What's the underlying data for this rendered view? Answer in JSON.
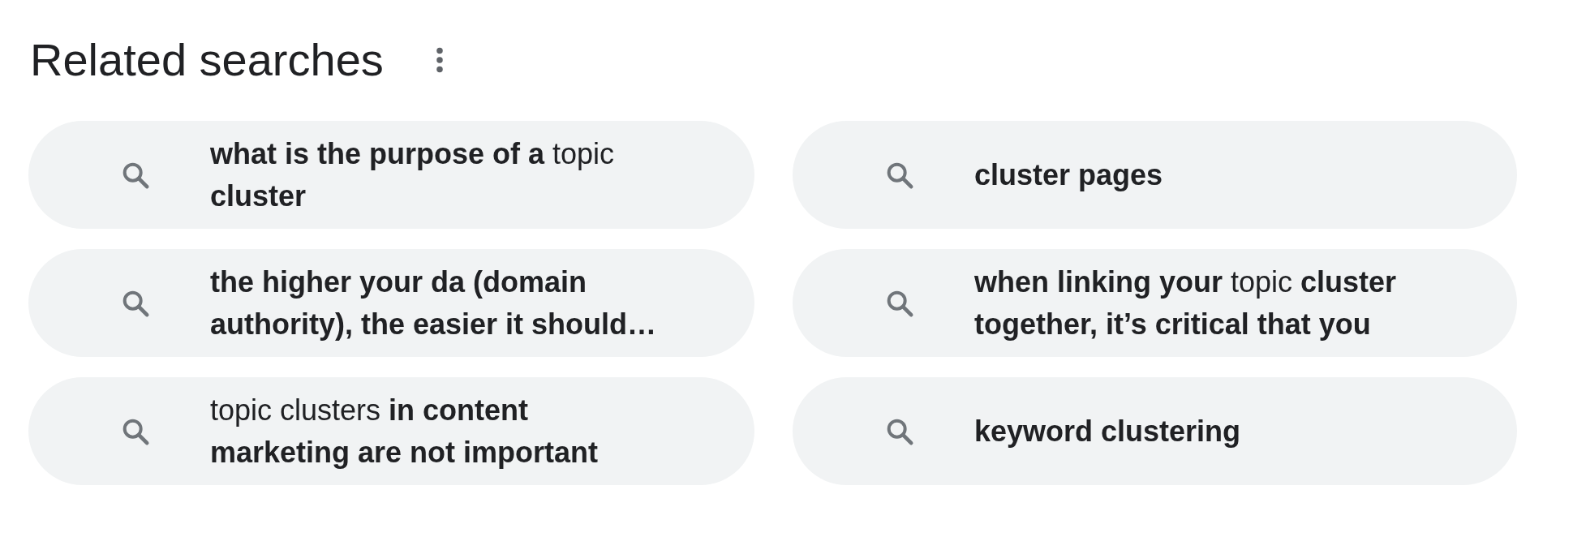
{
  "heading": {
    "title": "Related searches"
  },
  "searches": [
    {
      "text": "**what is the purpose of a** topic\n**cluster**",
      "bold": false
    },
    {
      "text": "cluster pages",
      "bold": true
    },
    {
      "text": "the higher your da (domain\nauthority), the easier it should…",
      "bold": true
    },
    {
      "text": "**when linking your** topic **cluster**\n**together, it’s critical that you**",
      "bold": false
    },
    {
      "text": "topic clusters **in content**\n**marketing are not important**",
      "bold": false
    },
    {
      "text": "keyword clustering",
      "bold": true
    }
  ]
}
